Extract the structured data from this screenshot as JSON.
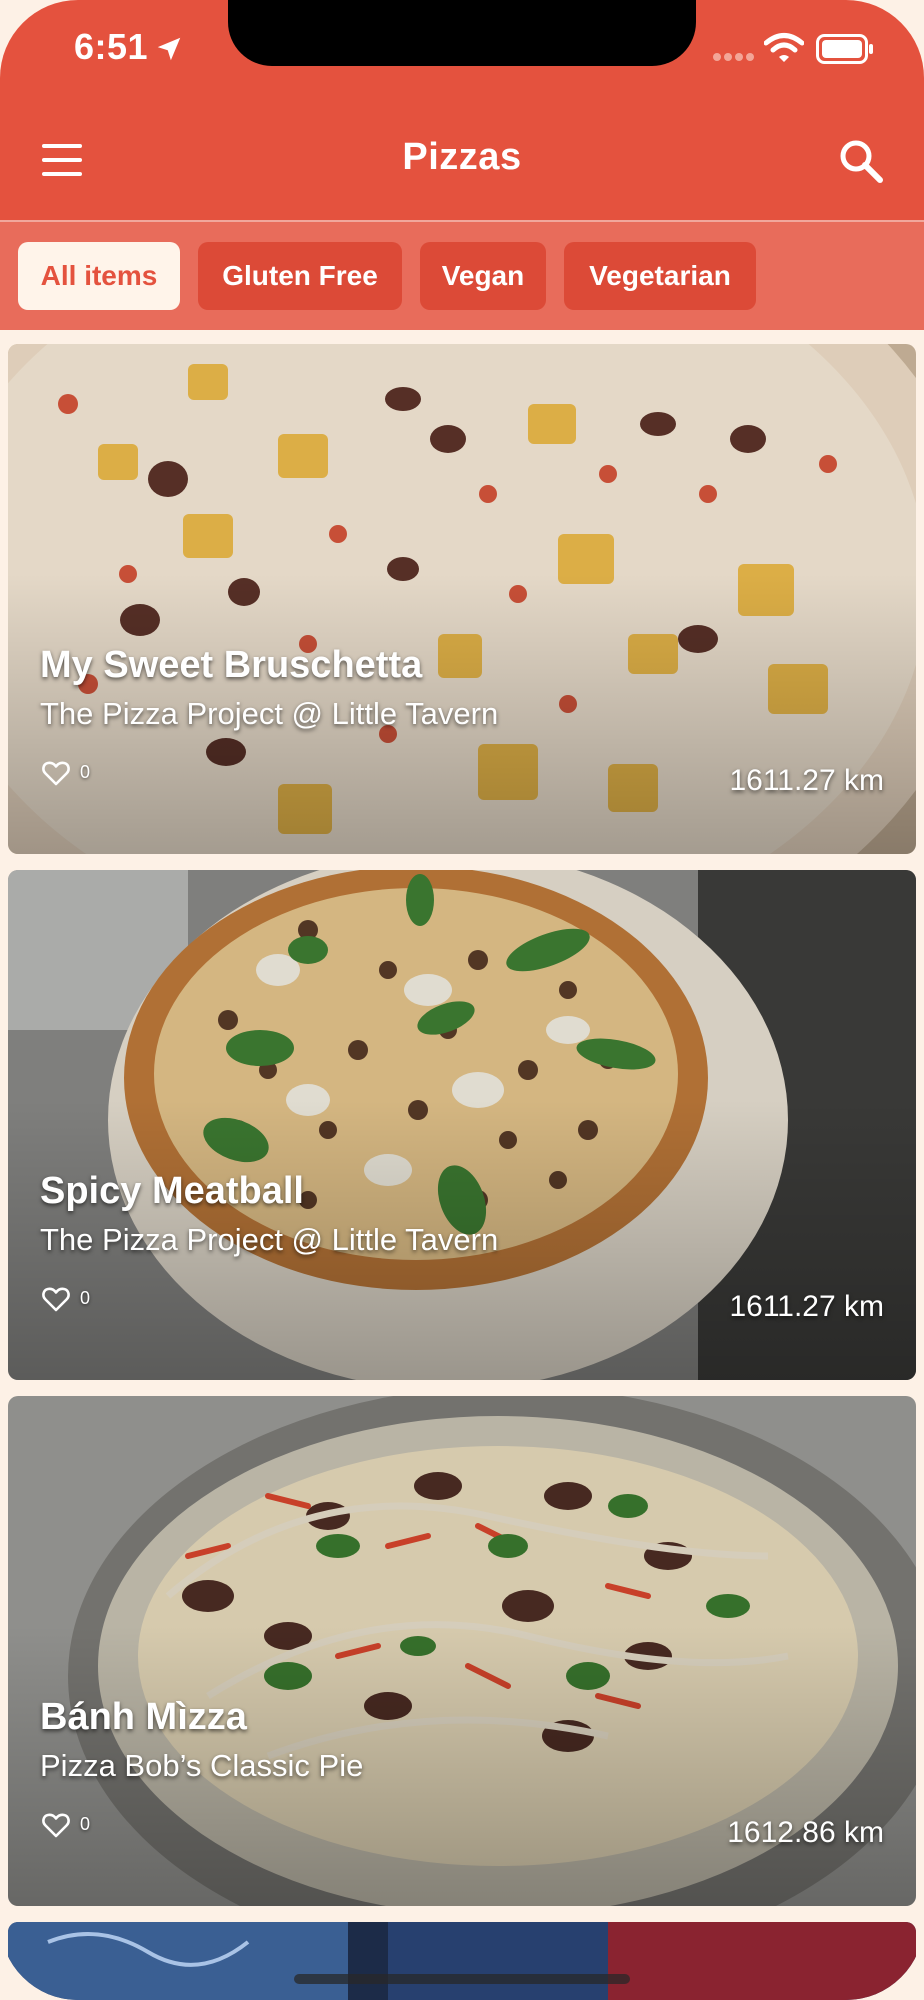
{
  "status_bar": {
    "time": "6:51"
  },
  "app_bar": {
    "title": "Pizzas"
  },
  "filters": [
    {
      "label": "All items",
      "active": true
    },
    {
      "label": "Gluten Free",
      "active": false
    },
    {
      "label": "Vegan",
      "active": false
    },
    {
      "label": "Vegetarian",
      "active": false
    }
  ],
  "items": [
    {
      "name": "My Sweet Bruschetta",
      "venue": "The Pizza Project @ Little Tavern",
      "likes": "0",
      "distance": "1611.27 km"
    },
    {
      "name": "Spicy Meatball",
      "venue": "The Pizza Project @ Little Tavern",
      "likes": "0",
      "distance": "1611.27 km"
    },
    {
      "name": "Bánh Mìzza",
      "venue": "Pizza Bob’s Classic Pie",
      "likes": "0",
      "distance": "1612.86 km"
    }
  ],
  "colors": {
    "primary": "#e4523e",
    "chip_bar": "#e86c5b",
    "chip": "#dc4a37",
    "chip_active_bg": "#fff4ea",
    "background": "#fdf1e6"
  },
  "icons": {
    "menu": "menu-icon",
    "search": "search-icon",
    "like": "heart-icon",
    "location": "location-arrow-icon",
    "wifi": "wifi-icon",
    "battery": "battery-icon",
    "signal": "cellular-signal-icon"
  }
}
